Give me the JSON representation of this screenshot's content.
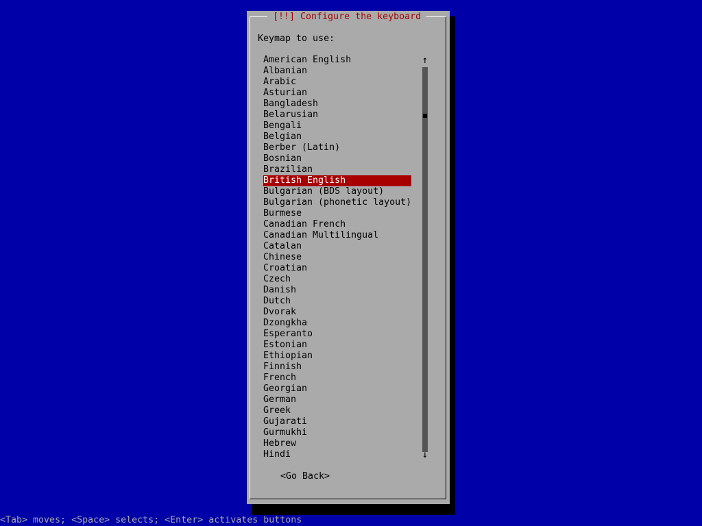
{
  "dialog": {
    "title": "[!!] Configure the keyboard",
    "prompt": "Keymap to use:",
    "options": [
      "American English",
      "Albanian",
      "Arabic",
      "Asturian",
      "Bangladesh",
      "Belarusian",
      "Bengali",
      "Belgian",
      "Berber (Latin)",
      "Bosnian",
      "Brazilian",
      "British English",
      "Bulgarian (BDS layout)",
      "Bulgarian (phonetic layout)",
      "Burmese",
      "Canadian French",
      "Canadian Multilingual",
      "Catalan",
      "Chinese",
      "Croatian",
      "Czech",
      "Danish",
      "Dutch",
      "Dvorak",
      "Dzongkha",
      "Esperanto",
      "Estonian",
      "Ethiopian",
      "Finnish",
      "French",
      "Georgian",
      "German",
      "Greek",
      "Gujarati",
      "Gurmukhi",
      "Hebrew",
      "Hindi"
    ],
    "selected_option": "British English",
    "scroll_up_glyph": "↑",
    "scroll_down_glyph": "↓",
    "go_back_label": "<Go Back>"
  },
  "status_bar": {
    "text": "<Tab> moves; <Space> selects; <Enter> activates buttons"
  },
  "colors": {
    "background": "#0000a8",
    "dialog": "#aaaaaa",
    "title_text": "#a80000",
    "selection": "#a80000"
  }
}
